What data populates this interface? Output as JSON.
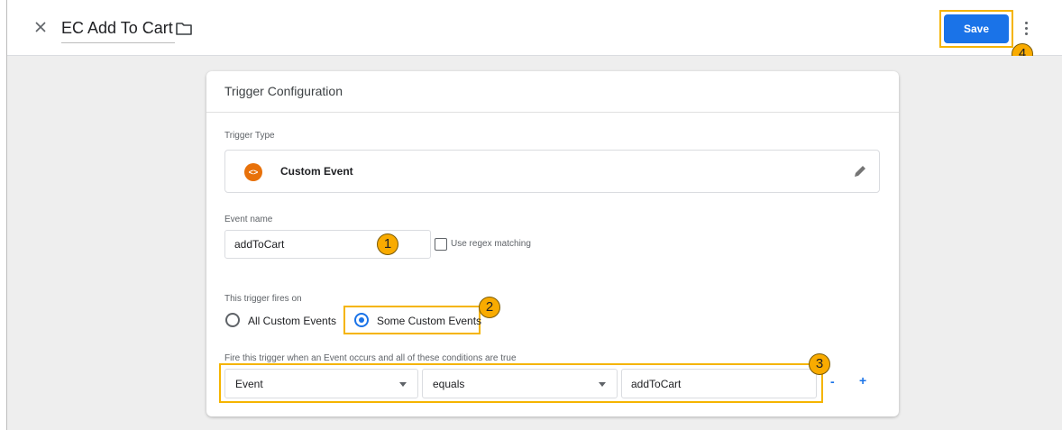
{
  "header": {
    "title": "EC Add To Cart",
    "save_label": "Save"
  },
  "card": {
    "title": "Trigger Configuration",
    "trigger_type_label": "Trigger Type",
    "trigger_type_name": "Custom Event",
    "trigger_type_icon_text": "<>",
    "event_name_label": "Event name",
    "event_name_value": "addToCart",
    "regex_label": "Use regex matching",
    "fires_on_label": "This trigger fires on",
    "fires_on_options": [
      "All Custom Events",
      "Some Custom Events"
    ],
    "fires_on_selected": "Some Custom Events",
    "conditions_label": "Fire this trigger when an Event occurs and all of these conditions are true",
    "condition": {
      "variable": "Event",
      "operator": "equals",
      "value": "addToCart"
    },
    "remove_label": "-",
    "add_label": "+"
  },
  "annotations": {
    "badges": [
      "1",
      "2",
      "3",
      "4"
    ],
    "highlight_color": "#f5b400"
  },
  "colors": {
    "accent": "#1a73e8",
    "custom_event_icon": "#e8710a",
    "canvas": "#eeeeee"
  }
}
